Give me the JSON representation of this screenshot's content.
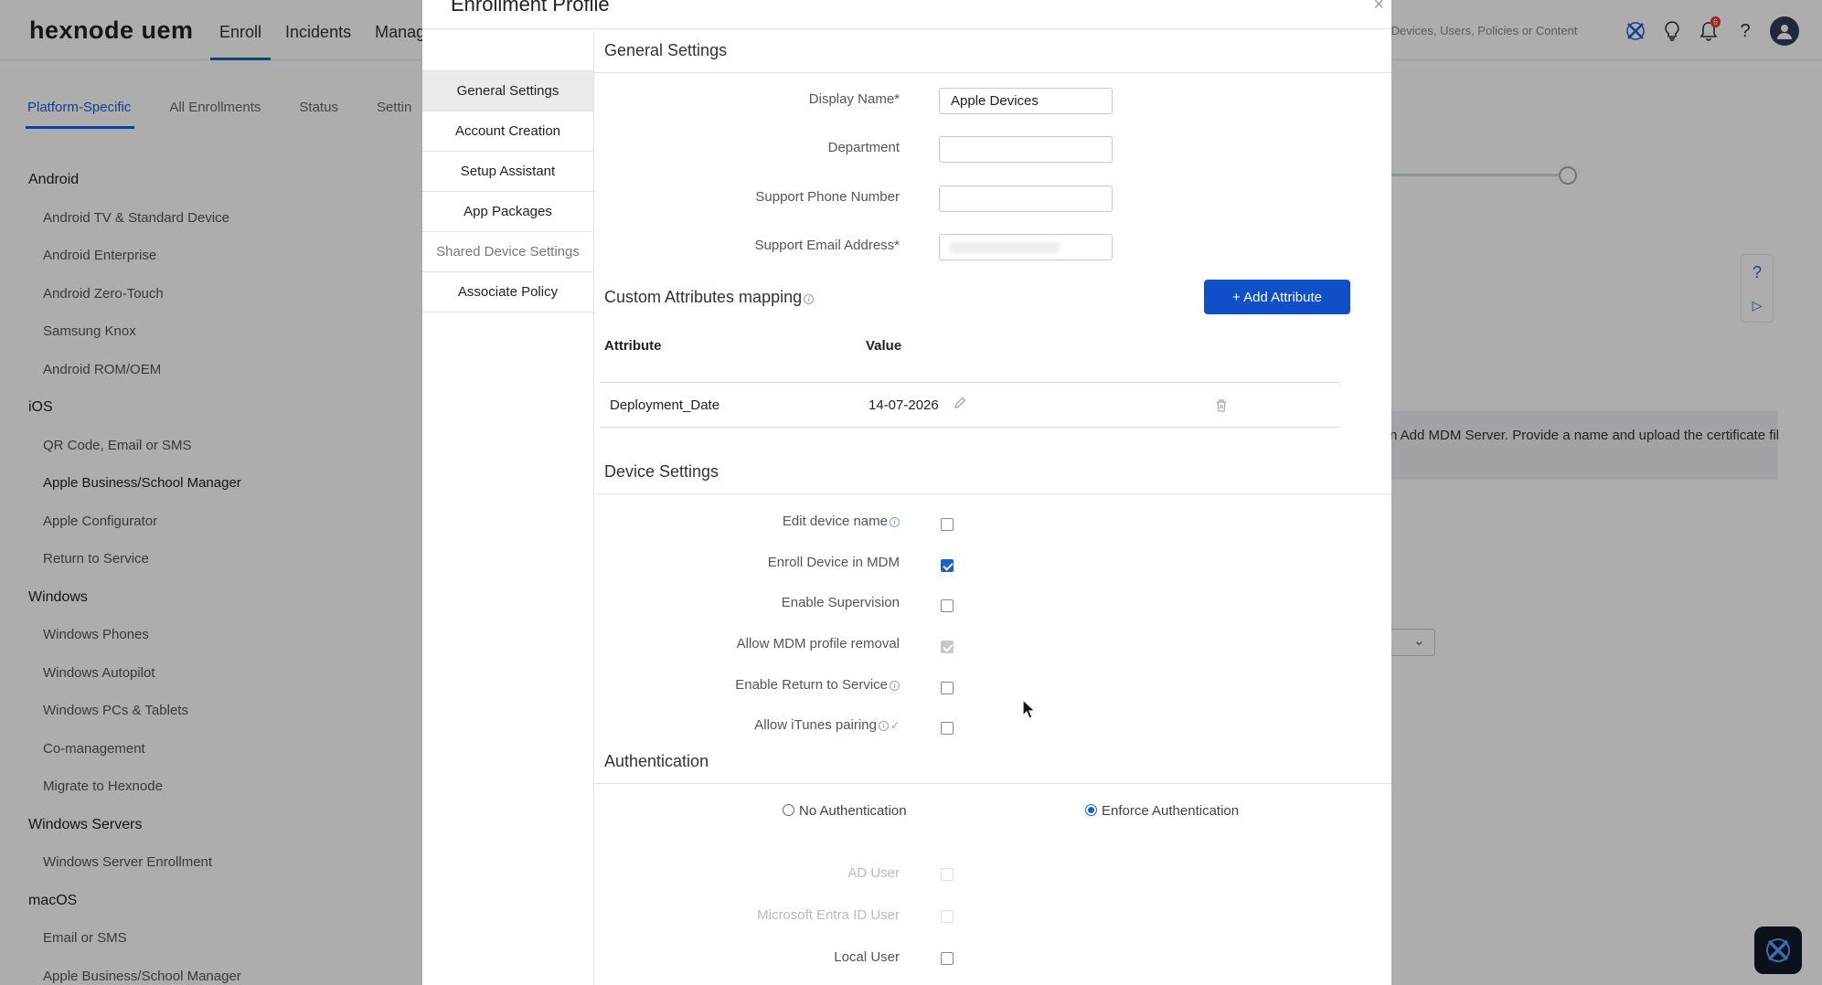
{
  "app": {
    "logo": "hexnode uem",
    "nav": [
      "Enroll",
      "Incidents",
      "Manage"
    ],
    "search_placeholder": "rch Devices, Users, Policies or Content",
    "notification_count": "6"
  },
  "subtabs": [
    "Platform-Specific",
    "All Enrollments",
    "Status",
    "Settin"
  ],
  "sidebar": [
    {
      "type": "group",
      "label": "Android"
    },
    {
      "type": "item",
      "label": "Android TV & Standard Device"
    },
    {
      "type": "item",
      "label": "Android Enterprise"
    },
    {
      "type": "item",
      "label": "Android Zero-Touch"
    },
    {
      "type": "item",
      "label": "Samsung Knox"
    },
    {
      "type": "item",
      "label": "Android ROM/OEM"
    },
    {
      "type": "group",
      "label": "iOS"
    },
    {
      "type": "item",
      "label": "QR Code, Email or SMS"
    },
    {
      "type": "item",
      "label": "Apple Business/School Manager",
      "active": true
    },
    {
      "type": "item",
      "label": "Apple Configurator"
    },
    {
      "type": "item",
      "label": "Return to Service"
    },
    {
      "type": "group",
      "label": "Windows"
    },
    {
      "type": "item",
      "label": "Windows Phones"
    },
    {
      "type": "item",
      "label": "Windows Autopilot"
    },
    {
      "type": "item",
      "label": "Windows PCs & Tablets"
    },
    {
      "type": "item",
      "label": "Co-management"
    },
    {
      "type": "item",
      "label": "Migrate to Hexnode"
    },
    {
      "type": "group",
      "label": "Windows Servers"
    },
    {
      "type": "item",
      "label": "Windows Server Enrollment"
    },
    {
      "type": "group",
      "label": "macOS"
    },
    {
      "type": "item",
      "label": "Email or SMS"
    },
    {
      "type": "item",
      "label": "Apple Business/School Manager"
    }
  ],
  "background": {
    "info_text": "n Add MDM Server. Provide a name and upload the certificate fil"
  },
  "modal": {
    "title": "Enrollment Profile",
    "close": "×",
    "nav": [
      "General Settings",
      "Account Creation",
      "Setup Assistant",
      "App Packages",
      "Shared Device Settings",
      "Associate Policy"
    ],
    "general": {
      "title": "General Settings",
      "display_name_label": "Display Name*",
      "display_name_value": "Apple Devices",
      "department_label": "Department",
      "department_value": "",
      "phone_label": "Support Phone Number",
      "phone_value": "",
      "email_label": "Support Email Address*"
    },
    "custom_attributes": {
      "title": "Custom Attributes mapping",
      "add_button": "+ Add Attribute",
      "col_attribute": "Attribute",
      "col_value": "Value",
      "rows": [
        {
          "attribute": "Deployment_Date",
          "value": "14-07-2026"
        }
      ]
    },
    "device_settings": {
      "title": "Device Settings",
      "items": [
        {
          "label": "Edit device name",
          "checked": false
        },
        {
          "label": "Enroll Device in MDM",
          "checked": true
        },
        {
          "label": "Enable Supervision",
          "checked": false
        },
        {
          "label": "Allow MDM profile removal",
          "checked": true,
          "disabled": true
        },
        {
          "label": "Enable Return to Service",
          "checked": false
        },
        {
          "label": "Allow iTunes pairing",
          "checked": false
        }
      ]
    },
    "authentication": {
      "title": "Authentication",
      "no_auth": "No Authentication",
      "enforce_auth": "Enforce Authentication",
      "selected": "Enforce Authentication",
      "ad_user": "AD User",
      "entra_user": "Microsoft Entra ID User",
      "local_user": "Local User"
    }
  }
}
